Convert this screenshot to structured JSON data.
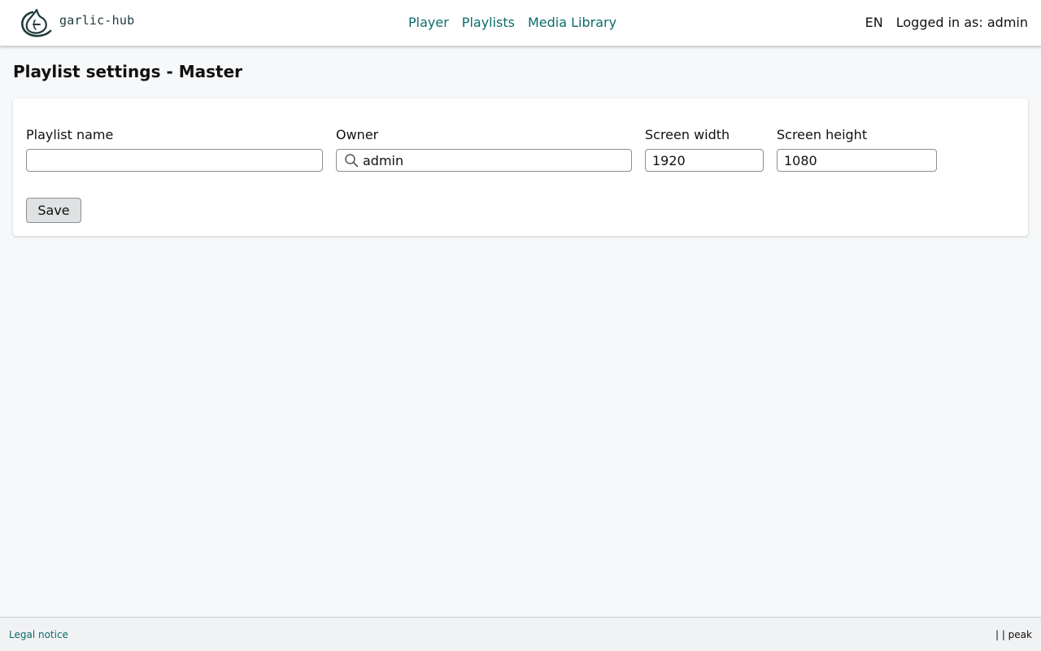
{
  "brand": {
    "name": "garlic-hub",
    "logo_icon": "garlic-logo-icon",
    "color": "#1f3a3c"
  },
  "nav": {
    "items": [
      {
        "label": "Player"
      },
      {
        "label": "Playlists"
      },
      {
        "label": "Media Library"
      }
    ],
    "link_color": "#0c6b6b"
  },
  "user_area": {
    "language": "EN",
    "logged_in_text": "Logged in as: admin"
  },
  "page": {
    "title": "Playlist settings - Master"
  },
  "form": {
    "playlist_name": {
      "label": "Playlist name",
      "value": "",
      "placeholder": ""
    },
    "owner": {
      "label": "Owner",
      "value": "admin",
      "icon": "search-icon"
    },
    "screen_width": {
      "label": "Screen width",
      "value": "1920"
    },
    "screen_height": {
      "label": "Screen height",
      "value": "1080"
    },
    "save_label": "Save"
  },
  "footer": {
    "legal_notice": "Legal notice",
    "right_text": "| | peak"
  }
}
